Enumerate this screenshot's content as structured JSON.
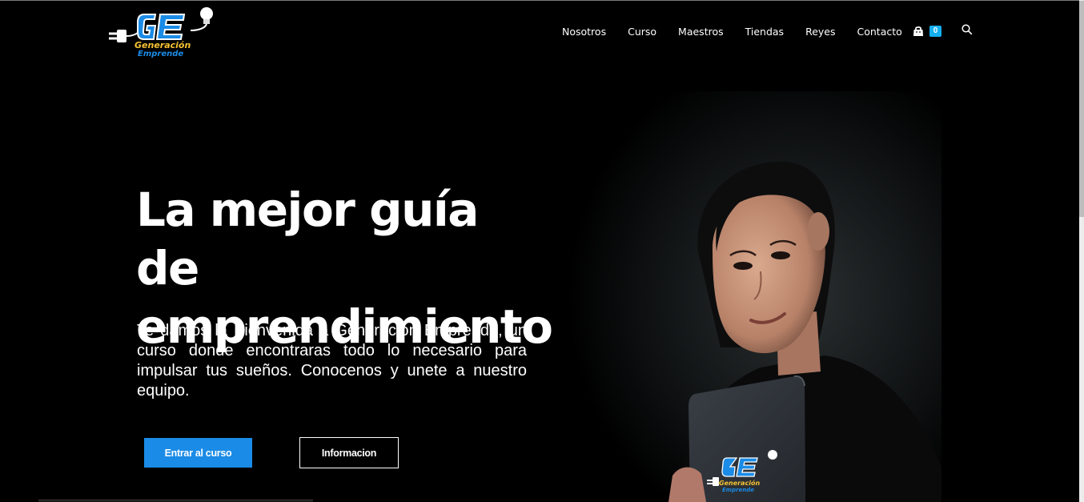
{
  "brand": {
    "logo_initials": "GE",
    "logo_line1": "Generación",
    "logo_line2": "Emprende",
    "accent_color": "#13aff0",
    "brand_blue": "#1a8be6",
    "brand_yellow": "#f6c233"
  },
  "nav": {
    "items": [
      {
        "label": "Nosotros"
      },
      {
        "label": "Curso"
      },
      {
        "label": "Maestros"
      },
      {
        "label": "Tiendas"
      },
      {
        "label": "Reyes"
      },
      {
        "label": "Contacto"
      }
    ],
    "cart_count": "0",
    "cart_icon": "shopping-bag-icon",
    "search_icon": "search-icon"
  },
  "hero": {
    "title_line1": "La mejor guía de",
    "title_line2": "emprendimiento",
    "text": "Te damos la Bienvenida a Generación Emprende, un curso donde encontraras todo lo necesario para impulsar tus sueños. Conocenos y unete a nuestro equipo.",
    "primary_button": "Entrar al curso",
    "secondary_button": "Informacion"
  }
}
